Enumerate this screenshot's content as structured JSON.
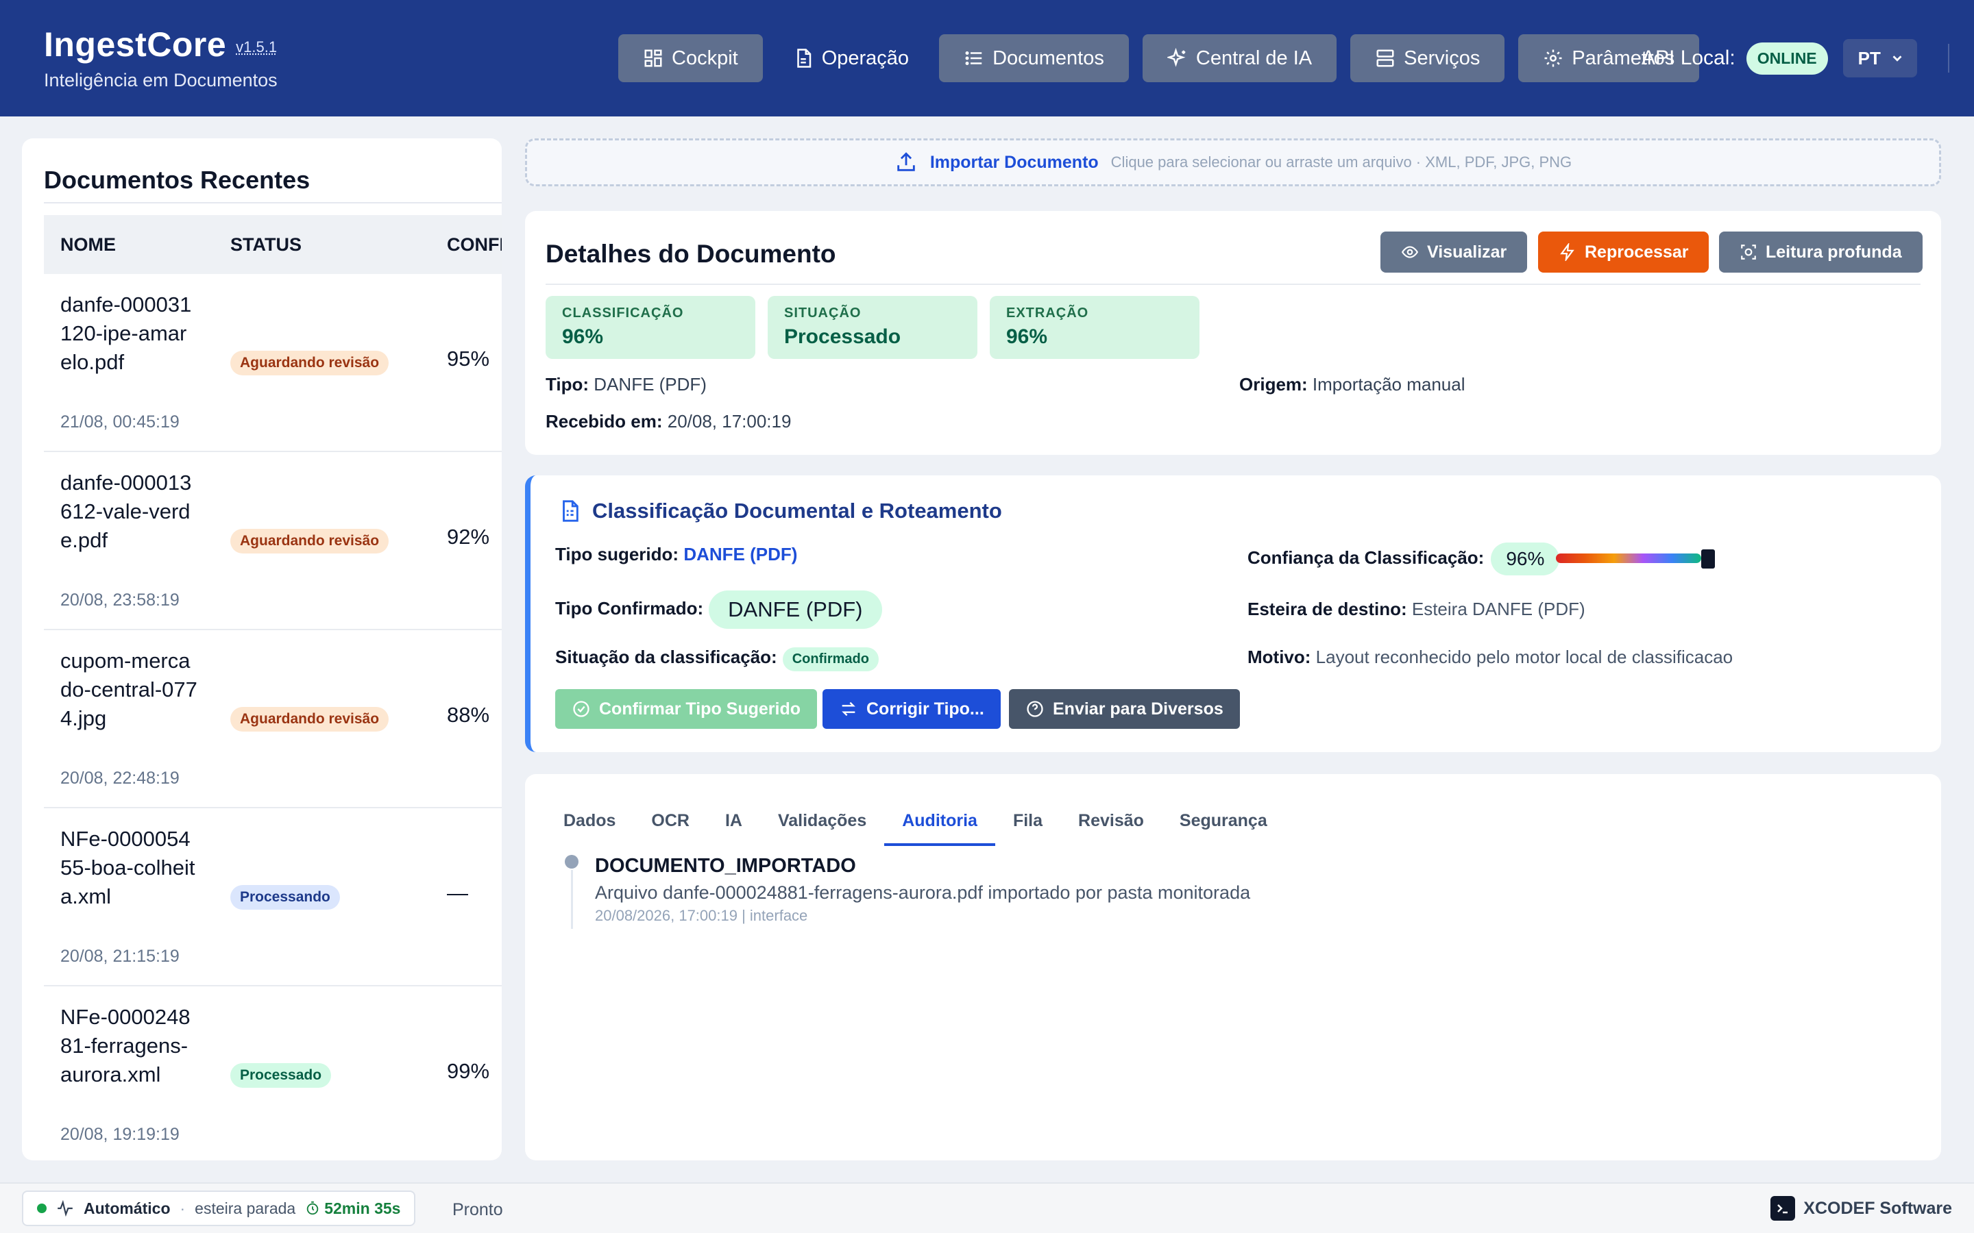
{
  "header": {
    "title": "IngestCore",
    "version": "v1.5.1",
    "subtitle": "Inteligência em Documentos",
    "nav": [
      {
        "label": "Cockpit",
        "icon": "dashboard-icon"
      },
      {
        "label": "Operação",
        "icon": "document-icon"
      },
      {
        "label": "Documentos",
        "icon": "list-icon"
      },
      {
        "label": "Central de IA",
        "icon": "sparkles-icon"
      },
      {
        "label": "Serviços",
        "icon": "server-icon"
      },
      {
        "label": "Parâmetros",
        "icon": "gear-icon"
      }
    ],
    "api_label": "API Local:",
    "api_status": "ONLINE",
    "language": "PT"
  },
  "recent": {
    "title": "Documentos Recentes",
    "columns": [
      "NOME",
      "STATUS",
      "CONFI"
    ],
    "rows": [
      {
        "name": "danfe-000031120-ipe-amarelo.pdf",
        "date": "21/08, 00:45:19",
        "status": "Aguardando revisão",
        "conf": "95%"
      },
      {
        "name": "danfe-000013612-vale-verde.pdf",
        "date": "20/08, 23:58:19",
        "status": "Aguardando revisão",
        "conf": "92%"
      },
      {
        "name": "cupom-mercado-central-0774.jpg",
        "date": "20/08, 22:48:19",
        "status": "Aguardando revisão",
        "conf": "88%"
      },
      {
        "name": "NFe-000005455-boa-colheita.xml",
        "date": "20/08, 21:15:19",
        "status": "Processando",
        "conf": "—"
      },
      {
        "name": "NFe-000024881-ferragens-aurora.xml",
        "date": "20/08, 19:19:19",
        "status": "Processado",
        "conf": "99%"
      }
    ]
  },
  "upload": {
    "label": "Importar Documento",
    "hint": "Clique para selecionar ou arraste um arquivo · XML, PDF, JPG, PNG"
  },
  "details": {
    "title": "Detalhes do Documento",
    "buttons": {
      "view": "Visualizar",
      "reprocess": "Reprocessar",
      "deep": "Leitura profunda"
    },
    "metrics": [
      {
        "label": "CLASSIFICAÇÃO",
        "value": "96%"
      },
      {
        "label": "SITUAÇÃO",
        "value": "Processado"
      },
      {
        "label": "EXTRAÇÃO",
        "value": "96%"
      }
    ],
    "tipo_label": "Tipo:",
    "tipo": "DANFE (PDF)",
    "origem_label": "Origem:",
    "origem": "Importação manual",
    "recebido_label": "Recebido em:",
    "recebido": "20/08, 17:00:19"
  },
  "classification": {
    "title": "Classificação Documental e Roteamento",
    "suggested_label": "Tipo sugerido:",
    "suggested": "DANFE (PDF)",
    "confirmed_label": "Tipo Confirmado:",
    "confirmed": "DANFE (PDF)",
    "situation_label": "Situação da classificação:",
    "situation": "Confirmado",
    "confidence_label": "Confiança da Classificação:",
    "confidence": "96%",
    "confidence_value": 0.96,
    "destination_label": "Esteira de destino:",
    "destination": "Esteira DANFE (PDF)",
    "reason_label": "Motivo:",
    "reason": "Layout reconhecido pelo motor local de classificacao",
    "buttons": {
      "confirm": "Confirmar Tipo Sugerido",
      "correct": "Corrigir Tipo...",
      "send": "Enviar para Diversos"
    }
  },
  "tabs": {
    "items": [
      "Dados",
      "OCR",
      "IA",
      "Validações",
      "Auditoria",
      "Fila",
      "Revisão",
      "Segurança"
    ],
    "active": "Auditoria",
    "event": {
      "title": "DOCUMENTO_IMPORTADO",
      "description": "Arquivo danfe-000024881-ferragens-aurora.pdf importado por pasta monitorada",
      "meta": "20/08/2026, 17:00:19 | interface"
    }
  },
  "footer": {
    "mode": "Automático",
    "separator": "·",
    "conveyor": "esteira parada",
    "timer": "52min 35s",
    "status": "Pronto",
    "brand": "XCODEF Software"
  },
  "colors": {
    "header_bg": "#1e3a8a",
    "reprocess": "#ea580c",
    "primary": "#1d4ed8",
    "success_bg": "#d1fae5"
  }
}
